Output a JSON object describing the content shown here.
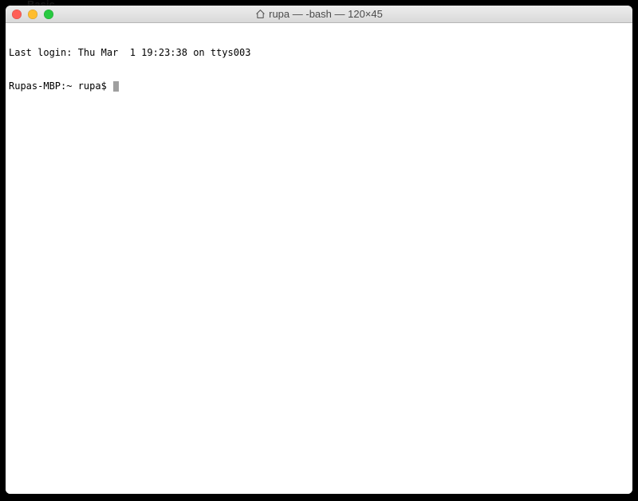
{
  "background_peek": {
    "prefix": "",
    "label": "Basic"
  },
  "window": {
    "title_icon": "home-icon",
    "title_text": "rupa — -bash — 120×45"
  },
  "terminal": {
    "motd": "Last login: Thu Mar  1 19:23:38 on ttys003",
    "prompt": "Rupas-MBP:~ rupa$ "
  }
}
